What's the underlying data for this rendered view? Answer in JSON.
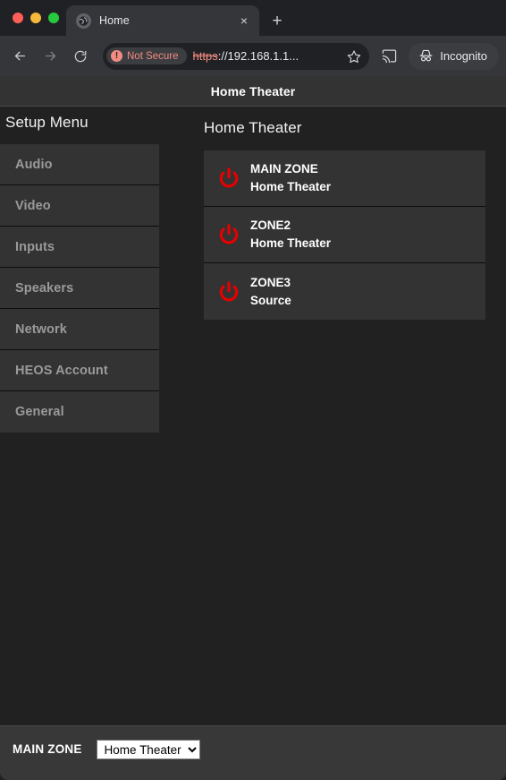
{
  "browser": {
    "tab": {
      "title": "Home",
      "favicon": "globe-icon",
      "close_label": "×"
    },
    "new_tab_label": "+",
    "nav": {
      "back": "back-arrow-icon",
      "forward": "forward-arrow-icon",
      "reload": "reload-icon"
    },
    "omnibox": {
      "security_badge": "Not Secure",
      "security_icon": "not-secure-icon",
      "url_scheme": "https",
      "url_rest": "://192.168.1.1...",
      "bookmark_icon": "star-icon"
    },
    "cast_icon": "cast-icon",
    "incognito": {
      "label": "Incognito",
      "icon": "incognito-icon"
    },
    "window_controls": {
      "close": "close-window",
      "minimize": "minimize-window",
      "zoom": "zoom-window"
    }
  },
  "page": {
    "header_title": "Home Theater",
    "setup_menu_label": "Setup Menu",
    "sidebar": {
      "items": [
        {
          "label": "Audio"
        },
        {
          "label": "Video"
        },
        {
          "label": "Inputs"
        },
        {
          "label": "Speakers"
        },
        {
          "label": "Network"
        },
        {
          "label": "HEOS Account"
        },
        {
          "label": "General"
        }
      ]
    },
    "content": {
      "heading": "Home Theater",
      "zones": [
        {
          "name": "MAIN ZONE",
          "source": "Home Theater",
          "power_icon": "power-icon"
        },
        {
          "name": "ZONE2",
          "source": "Home Theater",
          "power_icon": "power-icon"
        },
        {
          "name": "ZONE3",
          "source": "Source",
          "power_icon": "power-icon"
        }
      ]
    },
    "bottom_bar": {
      "label": "MAIN ZONE",
      "select_value": "Home Theater",
      "select_options": [
        "Home Theater"
      ]
    },
    "colors": {
      "power_red": "#e60000",
      "panel": "#333333",
      "page_bg": "#212121",
      "bottom_bar": "#383838"
    }
  }
}
